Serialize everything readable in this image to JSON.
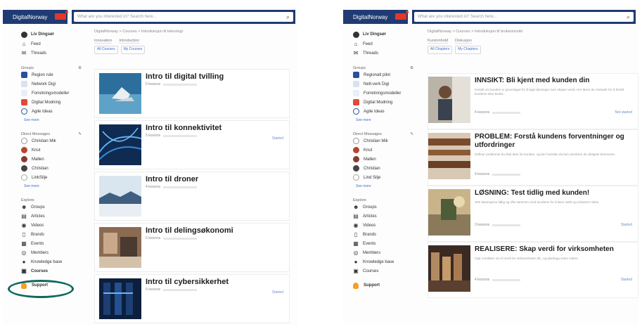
{
  "colors": {
    "brand_bar": "#1f3b73",
    "accent": "#3b6fd1",
    "ring": "#0f6a5d"
  },
  "left": {
    "brand": "DigitalNorway",
    "search_placeholder": "What are you interested in? Search here...",
    "user": "Liv Dingsør",
    "nav": [
      {
        "icon": "home-icon",
        "label": "Feed"
      },
      {
        "icon": "chat-icon",
        "label": "Threads"
      }
    ],
    "groups_head": "Groups",
    "groups": [
      "Region rule",
      "Network Digi",
      "Forretningsmodeller",
      "Digital Modning",
      "Agile Ideas"
    ],
    "groups_more": "See more",
    "direct_head": "Direct Messages",
    "direct": [
      "Christian Mik",
      "Knut",
      "Mallen",
      "Christian",
      "LinkSilje"
    ],
    "direct_more": "See more",
    "explore_head": "Explore",
    "explore": [
      {
        "icon": "groups-icon",
        "label": "Groups"
      },
      {
        "icon": "articles-icon",
        "label": "Articles"
      },
      {
        "icon": "videos-icon",
        "label": "Videos"
      },
      {
        "icon": "brands-icon",
        "label": "Brands"
      },
      {
        "icon": "events-icon",
        "label": "Events"
      },
      {
        "icon": "members-icon",
        "label": "Members"
      },
      {
        "icon": "knowledge-icon",
        "label": "Knowledge base"
      },
      {
        "icon": "courses-icon",
        "label": "Courses"
      }
    ],
    "support": "Support",
    "breadcrumb": "DigitalNorway > Courses > Introduksjon til teknologi",
    "tabs": [
      "Innovation",
      "Introduction"
    ],
    "filters": [
      "All Courses",
      "My Courses"
    ],
    "cards": [
      {
        "title": "Intro til digital tvilling",
        "meta": "5 lessons",
        "status": ""
      },
      {
        "title": "Intro til konnektivitet",
        "meta": "5 lessons",
        "status": "Started"
      },
      {
        "title": "Intro til droner",
        "meta": "4 lessons",
        "status": ""
      },
      {
        "title": "Intro til delingsøkonomi",
        "meta": "5 lessons",
        "status": ""
      },
      {
        "title": "Intro til cybersikkerhet",
        "meta": "5 lessons",
        "status": "Started"
      }
    ]
  },
  "right": {
    "brand": "DigitalNorway",
    "search_placeholder": "What are you interested in? Search here...",
    "user": "Liv Dingsør",
    "nav": [
      {
        "icon": "home-icon",
        "label": "Feed"
      },
      {
        "icon": "chat-icon",
        "label": "Threads"
      }
    ],
    "groups_head": "Groups",
    "groups": [
      "Regionalt pilot",
      "Nett-verk Digi",
      "Forretningsmodeller",
      "Digital Modning",
      "Agile Ideas"
    ],
    "groups_more": "See more",
    "direct_head": "Direct Messages",
    "direct": [
      "Christian Mik",
      "Knut",
      "Mallen",
      "Christian",
      "Lind Silje"
    ],
    "direct_more": "See more",
    "explore_head": "Explore",
    "explore": [
      {
        "icon": "groups-icon",
        "label": "Groups"
      },
      {
        "icon": "articles-icon",
        "label": "Articles"
      },
      {
        "icon": "videos-icon",
        "label": "Videos"
      },
      {
        "icon": "brands-icon",
        "label": "Brands"
      },
      {
        "icon": "events-icon",
        "label": "Events"
      },
      {
        "icon": "members-icon",
        "label": "Members"
      },
      {
        "icon": "knowledge-icon",
        "label": "Knowledge base"
      },
      {
        "icon": "courses-icon",
        "label": "Courses"
      }
    ],
    "support": "Support",
    "breadcrumb": "DigitalNorway > Courses > Introduksjon til brukerinnsikt",
    "tabs": [
      "Kursinnhold",
      "Diskusjon"
    ],
    "filters": [
      "All Chapters",
      "My Chapters"
    ],
    "cards": [
      {
        "title": "INNSIKT: Bli kjent med kunden din",
        "desc": "Innsikt om kunden er grunnlaget for å lage løsninger som skaper verdi. Her lærer du metoder for å forstå kundene dine bedre.",
        "meta": "4 lessons",
        "status": "Not started"
      },
      {
        "title": "PROBLEM: Forstå kundens forventninger og utfordringer",
        "desc": "Definer problemet du skal løse for kunden, og lær hvordan du kan prioritere de viktigste behovene.",
        "meta": "4 lessons",
        "status": ""
      },
      {
        "title": "LØSNING: Test tidlig med kunden!",
        "desc": "Test løsningene tidlig og ofte sammen med kundene for å lære raskt og redusere risiko.",
        "meta": "3 lessons",
        "status": "Started"
      },
      {
        "title": "REALISERE: Skap verdi for virksomheten",
        "desc": "Gjør innsikten om til verdi for virksomheten din, og planlegg veien videre.",
        "meta": "4 lessons",
        "status": "Started"
      }
    ]
  }
}
